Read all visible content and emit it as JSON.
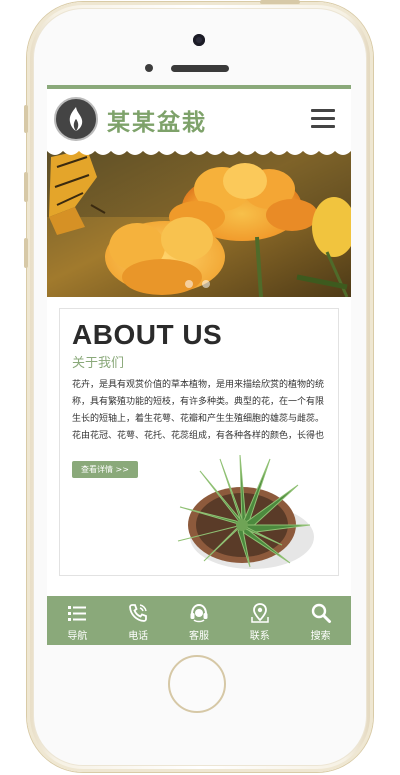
{
  "brand": {
    "name": "某某盆栽"
  },
  "banner": {
    "slides": 2
  },
  "about": {
    "title": "ABOUT US",
    "subtitle": "关于我们",
    "text": "花卉，是具有观赏价值的草本植物，是用来描绘欣赏的植物的统称，具有繁殖功能的短枝，有许多种类。典型的花，在一个有限生长的短轴上，着生花萼、花瓣和产生生殖细胞的雄蕊与雌蕊。花由花冠、花萼、花托、花蕊组成，有各种各样的颜色，长得也",
    "button_label": "查看详情 >>"
  },
  "bottom_nav": [
    {
      "label": "导航",
      "icon": "list-icon"
    },
    {
      "label": "电话",
      "icon": "phone-icon"
    },
    {
      "label": "客服",
      "icon": "headset-icon"
    },
    {
      "label": "联系",
      "icon": "map-pin-icon"
    },
    {
      "label": "搜索",
      "icon": "search-icon"
    }
  ],
  "colors": {
    "accent": "#8aa97a",
    "brand_text": "#7ea26a"
  }
}
